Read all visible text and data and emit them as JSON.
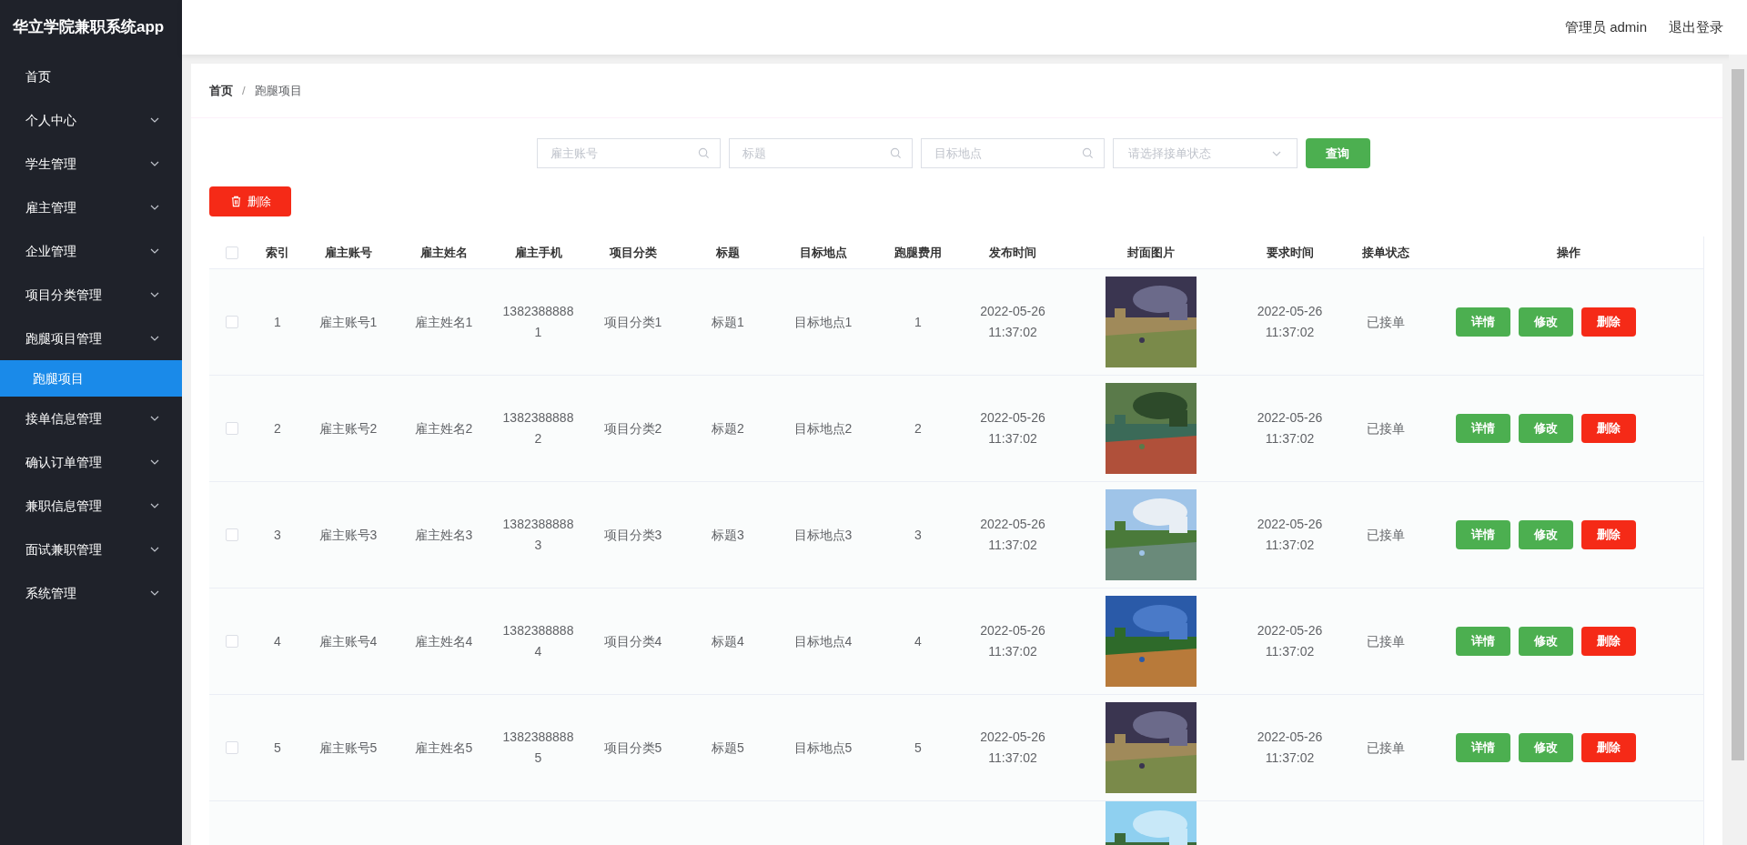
{
  "sidebar": {
    "title": "华立学院兼职系统app",
    "items": [
      {
        "label": "首页",
        "kind": "link"
      },
      {
        "label": "个人中心",
        "kind": "menu"
      },
      {
        "label": "学生管理",
        "kind": "menu"
      },
      {
        "label": "雇主管理",
        "kind": "menu"
      },
      {
        "label": "企业管理",
        "kind": "menu"
      },
      {
        "label": "项目分类管理",
        "kind": "menu"
      },
      {
        "label": "跑腿项目管理",
        "kind": "menu",
        "children": [
          {
            "label": "跑腿项目",
            "selected": true
          }
        ]
      },
      {
        "label": "接单信息管理",
        "kind": "menu"
      },
      {
        "label": "确认订单管理",
        "kind": "menu"
      },
      {
        "label": "兼职信息管理",
        "kind": "menu"
      },
      {
        "label": "面试兼职管理",
        "kind": "menu"
      },
      {
        "label": "系统管理",
        "kind": "menu"
      }
    ]
  },
  "header": {
    "user": "管理员 admin",
    "logout": "退出登录"
  },
  "breadcrumb": {
    "items": [
      "首页",
      "跑腿项目"
    ],
    "separator": "/"
  },
  "search": {
    "fields": [
      {
        "placeholder": "雇主账号"
      },
      {
        "placeholder": "标题"
      },
      {
        "placeholder": "目标地点"
      }
    ],
    "select": {
      "placeholder": "请选择接单状态"
    },
    "button": "查询"
  },
  "toolbar": {
    "delete": "删除"
  },
  "table": {
    "select_all_checked": false,
    "columns": [
      "索引",
      "雇主账号",
      "雇主姓名",
      "雇主手机",
      "项目分类",
      "标题",
      "目标地点",
      "跑腿费用",
      "发布时间",
      "封面图片",
      "要求时间",
      "接单状态",
      "操作"
    ],
    "rows": [
      {
        "checked": false,
        "cells": [
          "1",
          "雇主账号1",
          "雇主姓名1",
          "13823888881",
          "项目分类1",
          "标题1",
          "目标地点1",
          "1",
          "2022-05-26 11:37:02"
        ],
        "required_time": "2022-05-26 11:37:02",
        "status": "已接单",
        "actions": [
          "详情",
          "修改",
          "删除"
        ]
      },
      {
        "checked": false,
        "cells": [
          "2",
          "雇主账号2",
          "雇主姓名2",
          "13823888882",
          "项目分类2",
          "标题2",
          "目标地点2",
          "2",
          "2022-05-26 11:37:02"
        ],
        "required_time": "2022-05-26 11:37:02",
        "status": "已接单",
        "actions": [
          "详情",
          "修改",
          "删除"
        ]
      },
      {
        "checked": false,
        "cells": [
          "3",
          "雇主账号3",
          "雇主姓名3",
          "13823888883",
          "项目分类3",
          "标题3",
          "目标地点3",
          "3",
          "2022-05-26 11:37:02"
        ],
        "required_time": "2022-05-26 11:37:02",
        "status": "已接单",
        "actions": [
          "详情",
          "修改",
          "删除"
        ]
      },
      {
        "checked": false,
        "cells": [
          "4",
          "雇主账号4",
          "雇主姓名4",
          "13823888884",
          "项目分类4",
          "标题4",
          "目标地点4",
          "4",
          "2022-05-26 11:37:02"
        ],
        "required_time": "2022-05-26 11:37:02",
        "status": "已接单",
        "actions": [
          "详情",
          "修改",
          "删除"
        ]
      },
      {
        "checked": false,
        "cells": [
          "5",
          "雇主账号5",
          "雇主姓名5",
          "13823888885",
          "项目分类5",
          "标题5",
          "目标地点5",
          "5",
          "2022-05-26 11:37:02"
        ],
        "required_time": "2022-05-26 11:37:02",
        "status": "已接单",
        "actions": [
          "详情",
          "修改",
          "删除"
        ]
      }
    ]
  }
}
